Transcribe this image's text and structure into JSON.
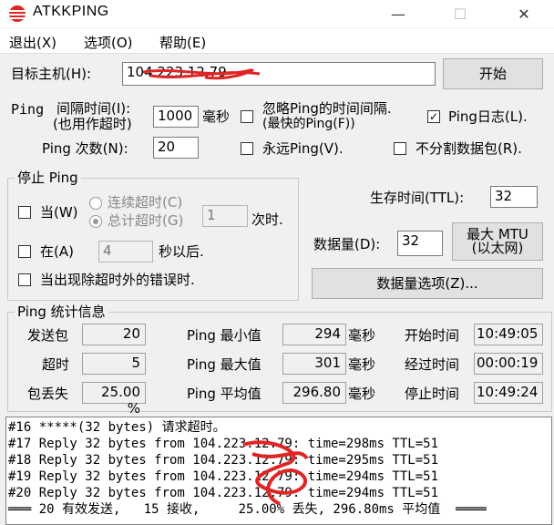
{
  "window": {
    "title": "ATKKPING",
    "minimize_glyph": "—",
    "maximize_glyph": "☐",
    "close_glyph": "✕",
    "icon": "app-logo-icon",
    "accent_color": "#e02424"
  },
  "menu": {
    "items": [
      "退出(X)",
      "选项(O)",
      "帮助(E)"
    ]
  },
  "host": {
    "label": "目标主机(H):",
    "value": "104.223.12.79",
    "start_button": "开始"
  },
  "options": {
    "interval_label_1": "间隔时间(I):",
    "interval_label_2": "(也用作超时)",
    "ping_prefix": "Ping",
    "interval_value": "1000",
    "interval_unit": "毫秒",
    "ignore_label_1": "忽略Ping的时间间隔.",
    "ignore_label_2": "(最快的Ping(F))",
    "ping_log_label": "Ping日志(L).",
    "ping_log_checked": true,
    "count_label": "Ping 次数(N):",
    "count_value": "20",
    "forever_label": "永远Ping(V).",
    "no_fragment_label": "不分割数据包(R)."
  },
  "stop_group": {
    "title": "停止 Ping",
    "when_label": "当(W)",
    "consecutive_timeout_label": "连续超时(C)",
    "total_timeout_label": "总计超时(G)",
    "times_value": "1",
    "times_unit": "次时.",
    "at_label": "在(A)",
    "at_value": "4",
    "at_unit": "秒以后.",
    "other_error_label": "当出现除超时外的错误时."
  },
  "ttl": {
    "label": "生存时间(TTL):",
    "value": "32"
  },
  "data_size": {
    "label": "数据量(D):",
    "value": "32",
    "max_mtu_button": "最大 MTU\n(以太网)",
    "options_button": "数据量选项(Z)..."
  },
  "stats": {
    "title": "Ping  统计信息",
    "sent_label": "发送包",
    "sent_value": "20",
    "timeout_label": "超时",
    "timeout_value": "5",
    "loss_label": "包丢失",
    "loss_value": "25.00 %",
    "min_label": "Ping 最小值",
    "min_value": "294",
    "max_label": "Ping 最大值",
    "max_value": "301",
    "avg_label": "Ping 平均值",
    "avg_value": "296.80",
    "ms_unit": "毫秒",
    "start_time_label": "开始时间",
    "start_time_value": "10:49:05",
    "elapsed_label": "经过时间",
    "elapsed_value": "00:00:19",
    "stop_time_label": "停止时间",
    "stop_time_value": "10:49:24"
  },
  "log": {
    "lines": [
      "#16 *****(32 bytes) 请求超时。",
      "#17 Reply 32 bytes from 104.223.12.79: time=298ms TTL=51",
      "#18 Reply 32 bytes from 104.223.12.79: time=295ms TTL=51",
      "#19 Reply 32 bytes from 104.223.12.79: time=294ms TTL=51",
      "#20 Reply 32 bytes from 104.223.12.79: time=294ms TTL=51",
      "═══ 20 有效发送,   15 接收,     25.00% 丢失, 296.80ms 平均值  ════"
    ]
  }
}
